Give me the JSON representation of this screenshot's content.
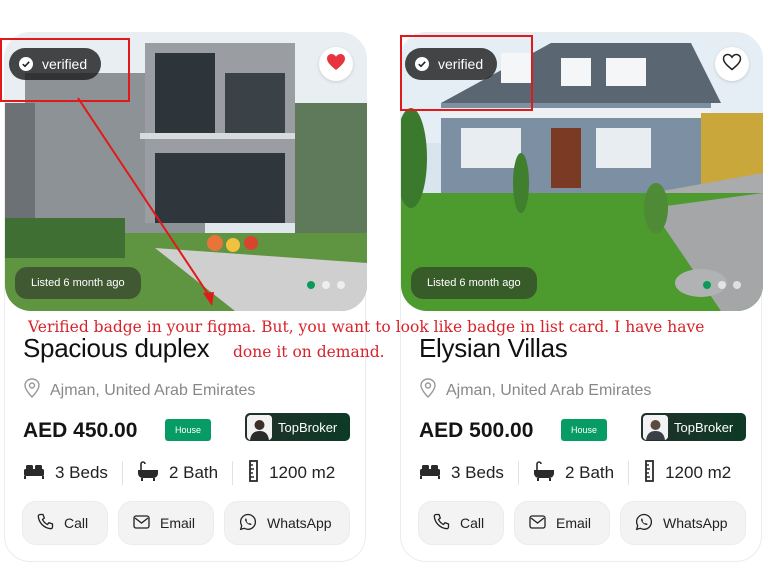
{
  "cards": [
    {
      "verified_label": "verified",
      "favorited": true,
      "listed": "Listed 6 month ago",
      "title": "Spacious duplex",
      "location": "Ajman, United Arab Emirates",
      "price": "AED 450.00",
      "type": "House",
      "broker": "TopBroker",
      "beds": "3 Beds",
      "bath": "2 Bath",
      "area": "1200 m2",
      "actions": {
        "call": "Call",
        "email": "Email",
        "whatsapp": "WhatsApp"
      }
    },
    {
      "verified_label": "verified",
      "favorited": false,
      "listed": "Listed 6 month ago",
      "title": "Elysian Villas",
      "location": "Ajman, United Arab Emirates",
      "price": "AED 500.00",
      "type": "House",
      "broker": "TopBroker",
      "beds": "3 Beds",
      "bath": "2 Bath",
      "area": "1200 m2",
      "actions": {
        "call": "Call",
        "email": "Email",
        "whatsapp": "WhatsApp"
      }
    }
  ],
  "annotation": {
    "line1": "Verified badge in your figma. But, you  want to look like badge in list card. I have have",
    "line2": "done it on  demand."
  },
  "colors": {
    "accent": "#079b66",
    "annotation": "#e01a1a",
    "heart": "#e8343c"
  }
}
